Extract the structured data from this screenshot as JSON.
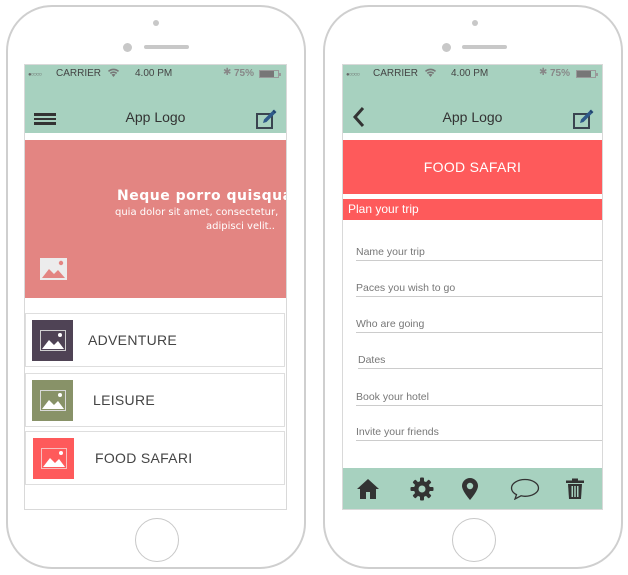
{
  "colors": {
    "header_bg": "#a7d1bf",
    "hero_bg": "#e38582",
    "accent_red": "#fe5a5b",
    "adventure": "#4f4355",
    "leisure": "#889268",
    "food_safari": "#fe5a5b"
  },
  "left_screen": {
    "status": {
      "signal_icon": "signal-dots-icon",
      "signal": "●○○○○",
      "carrier": "CARRIER",
      "wifi_icon": "wifi-icon",
      "time": "4.00 PM",
      "bluetooth_icon": "bluetooth-icon",
      "battery": "75%",
      "battery_icon": "battery-icon"
    },
    "navbar": {
      "menu_icon": "hamburger-icon",
      "title": "App Logo",
      "edit_icon": "edit-icon"
    },
    "hero": {
      "title": "Neque porro quisquam",
      "subtitle_line1": "quia dolor sit amet, consectetur,",
      "subtitle_line2": "adipisci velit..",
      "image_icon": "image-placeholder-icon"
    },
    "categories": [
      {
        "label": "ADVENTURE",
        "icon": "image-icon"
      },
      {
        "label": "LEISURE",
        "icon": "image-icon"
      },
      {
        "label": "FOOD SAFARI",
        "icon": "image-icon"
      }
    ]
  },
  "right_screen": {
    "status": {
      "signal": "●○○○○",
      "carrier": "CARRIER",
      "time": "4.00 PM",
      "battery": "75%"
    },
    "navbar": {
      "back_icon": "chevron-left-icon",
      "title": "App Logo",
      "edit_icon": "edit-icon"
    },
    "banner_title": "FOOD SAFARI",
    "section_title": "Plan your trip",
    "fields": [
      {
        "placeholder": "Name your trip",
        "value": ""
      },
      {
        "placeholder": "Paces you wish to go",
        "value": ""
      },
      {
        "placeholder": "Who are going",
        "value": ""
      },
      {
        "placeholder": "Dates",
        "value": ""
      },
      {
        "placeholder": "Book your hotel",
        "value": ""
      },
      {
        "placeholder": "Invite your friends",
        "value": ""
      }
    ],
    "tabbar": [
      {
        "name": "home",
        "icon": "home-icon"
      },
      {
        "name": "settings",
        "icon": "gear-icon"
      },
      {
        "name": "location",
        "icon": "map-pin-icon"
      },
      {
        "name": "chat",
        "icon": "chat-bubble-icon"
      },
      {
        "name": "delete",
        "icon": "trash-icon"
      }
    ]
  }
}
